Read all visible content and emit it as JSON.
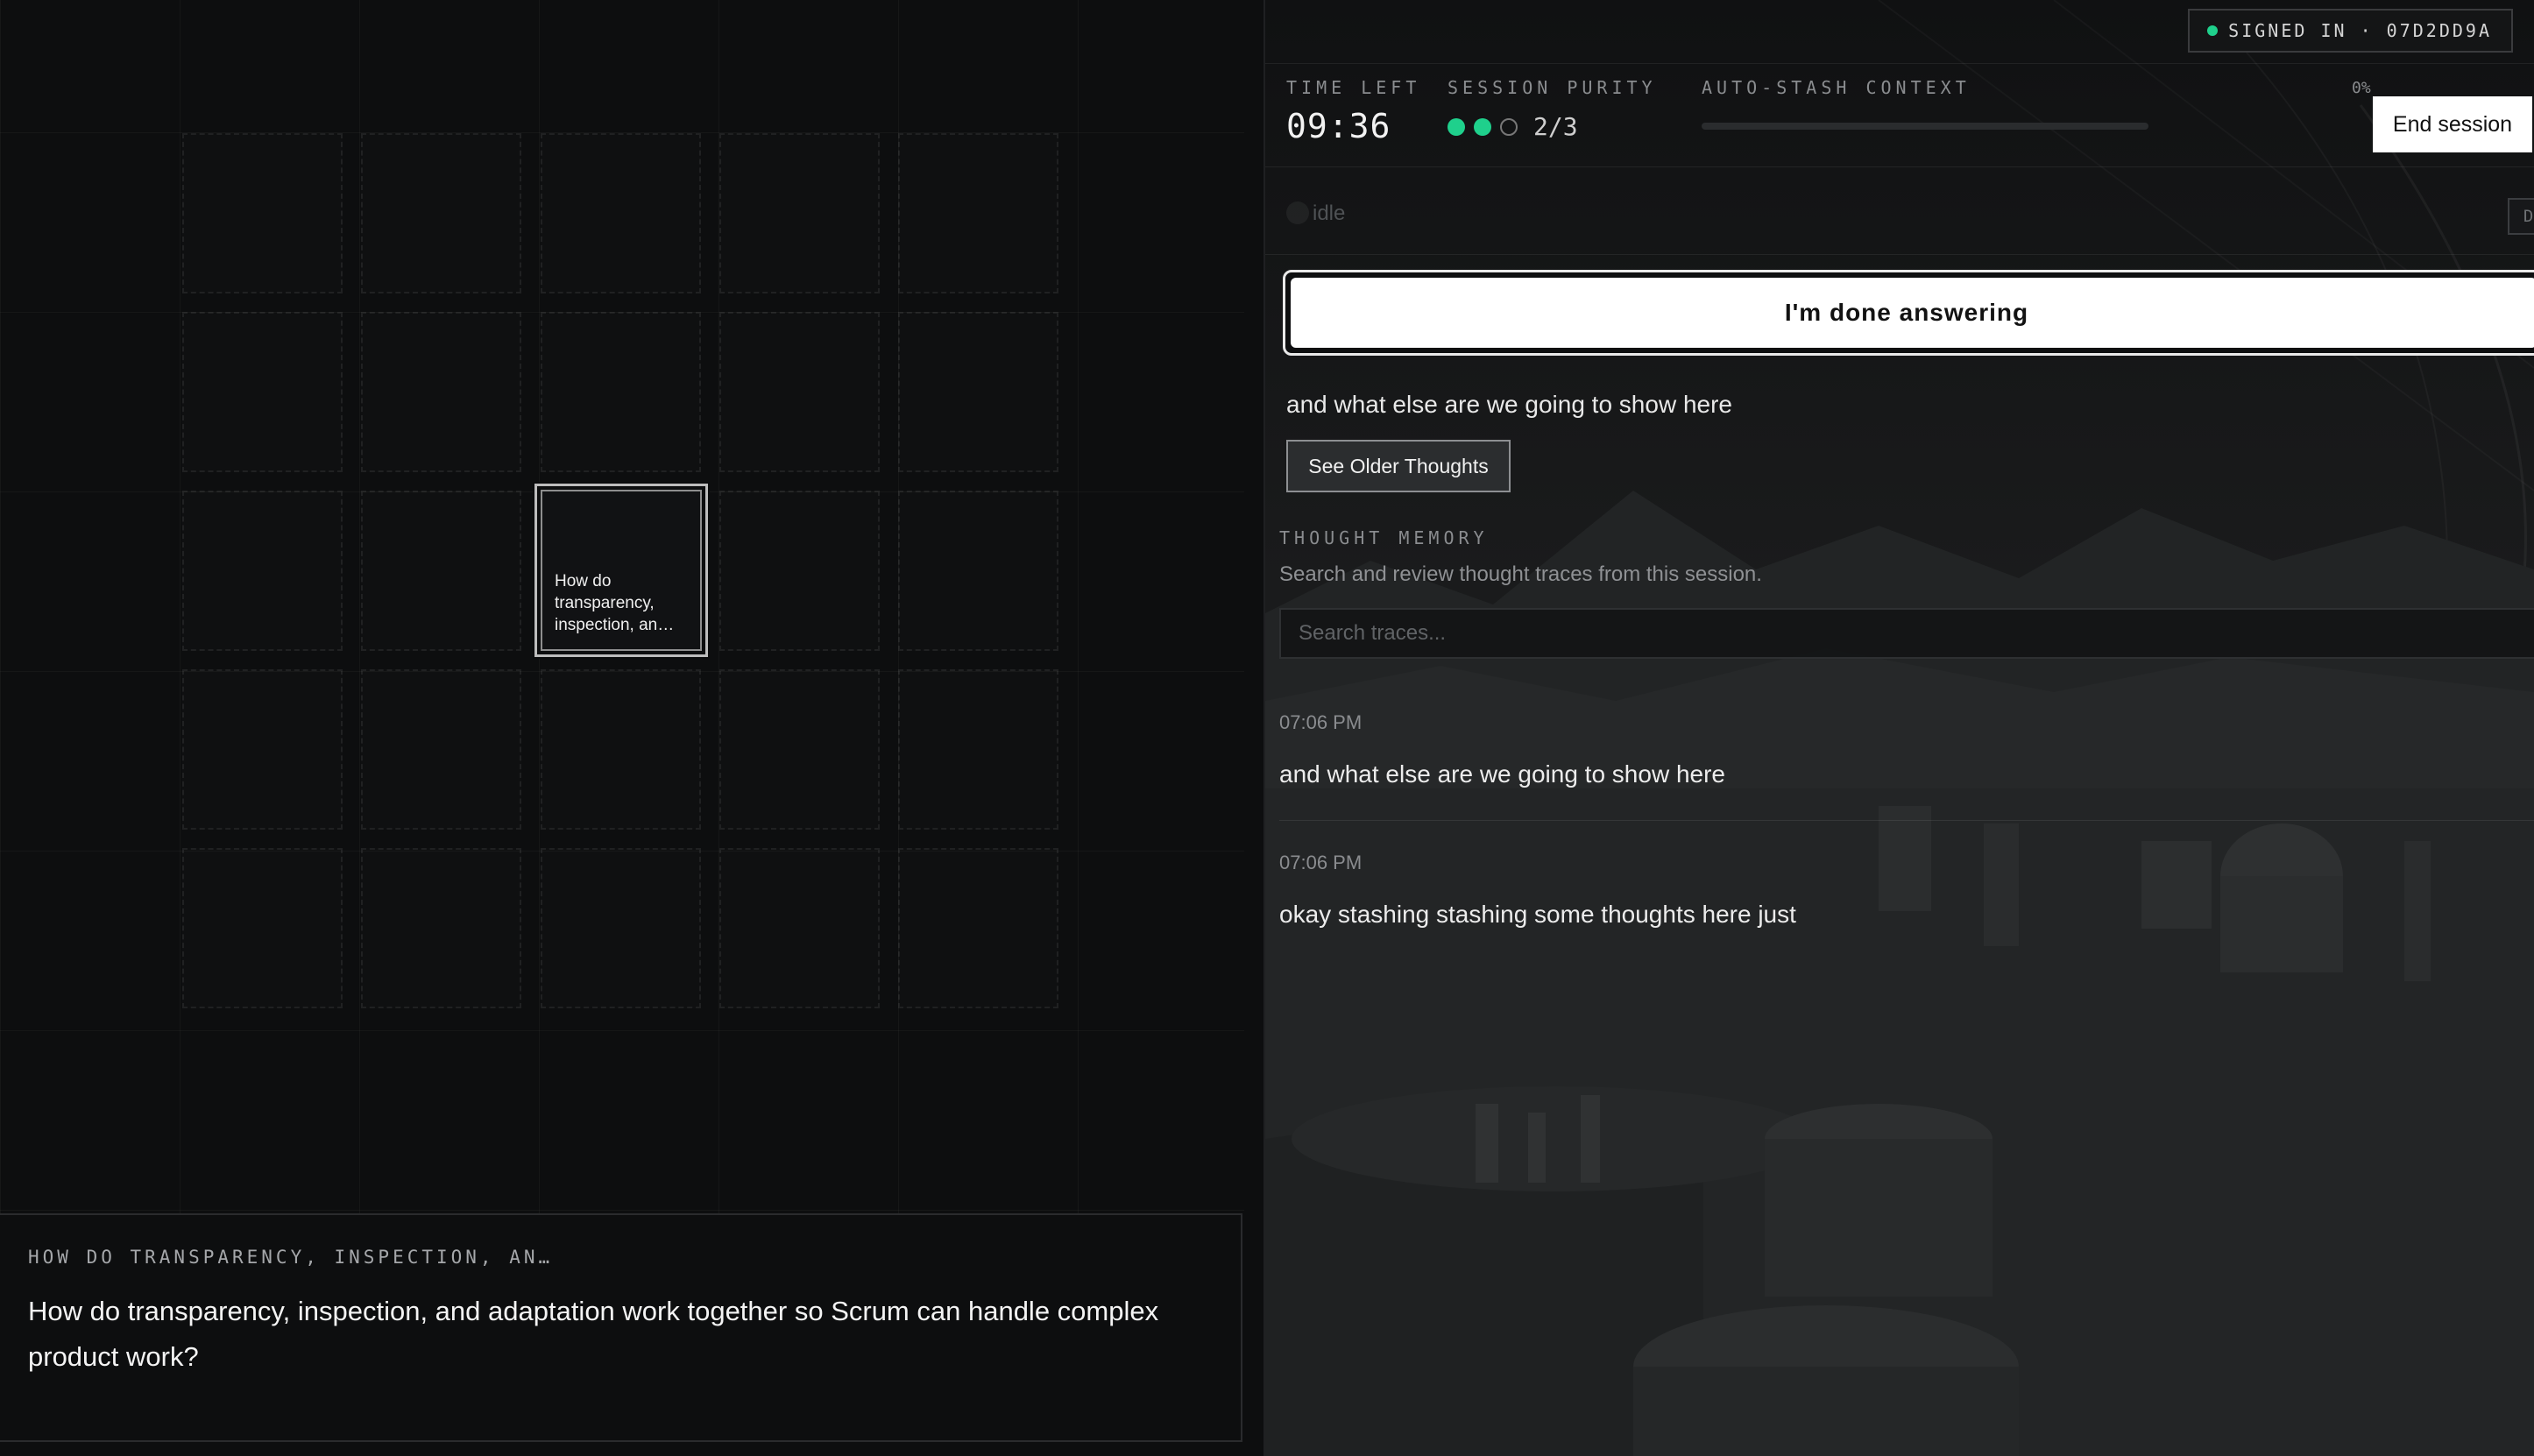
{
  "question_box": {
    "label": "HOW DO TRANSPARENCY, INSPECTION, AN…",
    "text": "How do transparency, inspection, and adaptation work together so Scrum can handle complex product work?"
  },
  "grid": {
    "active_card_text": "How do transparency, inspection, an…"
  },
  "header": {
    "signed_in_label": "SIGNED IN · 07D2DD9A",
    "time_left_label": "TIME LEFT",
    "time_left_value": "09:36",
    "purity_label": "SESSION PURITY",
    "purity_value": "2/3",
    "purity_filled": 2,
    "purity_total": 3,
    "context_label": "AUTO-STASH CONTEXT",
    "context_percent": "0%",
    "context_fraction": 0.0,
    "end_session_label": "End session"
  },
  "input_row": {
    "status_text": "idle",
    "delete_label": "Del"
  },
  "done_button_label": "I'm done answering",
  "current_thought": "and what else are we going to show here",
  "older_thoughts_label": "See Older Thoughts",
  "memory": {
    "label": "THOUGHT MEMORY",
    "subtitle": "Search and review thought traces from this session.",
    "search_placeholder": "Search traces...",
    "traces": [
      {
        "time": "07:06 PM",
        "text": "and what else are we going to show here"
      },
      {
        "time": "07:06 PM",
        "text": "okay stashing stashing some thoughts here just"
      }
    ]
  },
  "colors": {
    "accent_green": "#1fd08c",
    "background": "#0b0c0d",
    "button_white": "#ffffff"
  }
}
